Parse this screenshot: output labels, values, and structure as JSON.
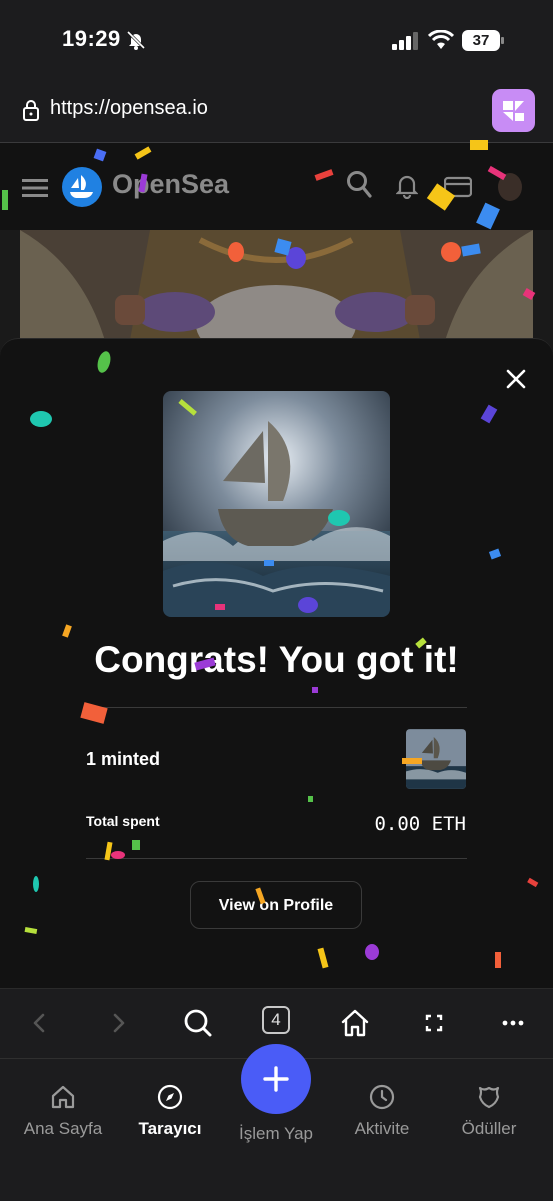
{
  "status_bar": {
    "time": "19:29",
    "battery": "37",
    "icons": [
      "bell-slash-icon",
      "signal-icon",
      "wifi-icon",
      "battery-icon"
    ]
  },
  "browser": {
    "url": "https://opensea.io",
    "extension_icon": "extension-icon"
  },
  "site_header": {
    "brand": "OpenSea",
    "icons": [
      "menu-icon",
      "opensea-logo-icon",
      "search-icon",
      "bell-icon",
      "wallet-icon",
      "avatar"
    ]
  },
  "modal": {
    "title": "Congrats! You got it!",
    "minted_label": "1 minted",
    "total_spent_label": "Total spent",
    "total_spent_value": "0.00 ETH",
    "view_profile_label": "View on Profile",
    "close_icon": "close-icon"
  },
  "browser_toolbar": {
    "tab_count": "4",
    "icons": [
      "back-icon",
      "forward-icon",
      "search-icon",
      "tabs-icon",
      "home-icon",
      "fullscreen-icon",
      "more-icon"
    ]
  },
  "bottom_nav": {
    "items": [
      {
        "label": "Ana Sayfa",
        "icon": "home-icon"
      },
      {
        "label": "Tarayıcı",
        "icon": "compass-icon",
        "active": true
      },
      {
        "label": "İşlem Yap",
        "icon": "plus-icon"
      },
      {
        "label": "Aktivite",
        "icon": "clock-icon"
      },
      {
        "label": "Ödüller",
        "icon": "rewards-icon"
      }
    ]
  },
  "colors": {
    "accent": "#4a5cf7",
    "background": "#121212",
    "extension": "#c88cf5"
  }
}
